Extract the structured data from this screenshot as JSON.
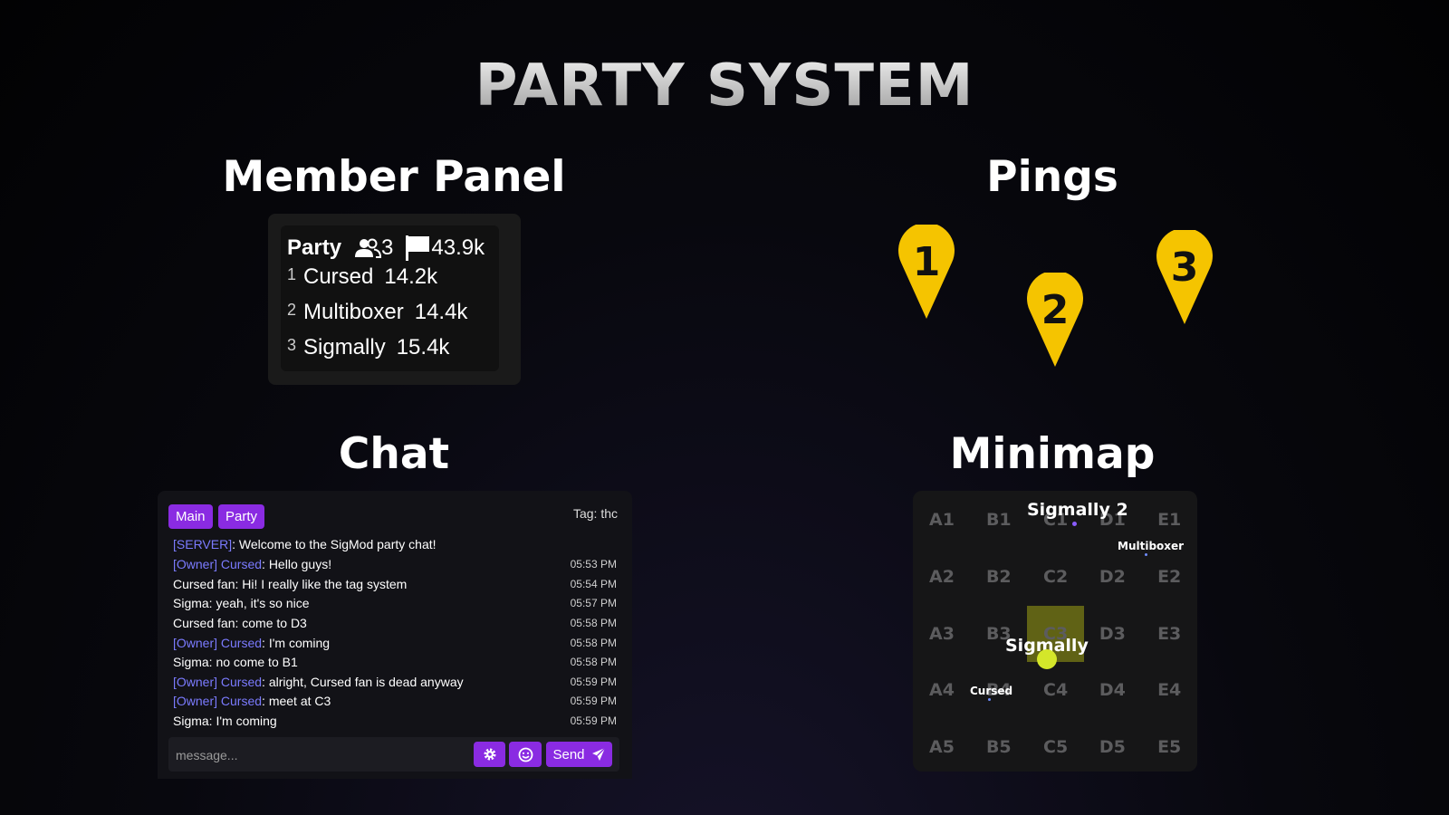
{
  "title": "PARTY SYSTEM",
  "sections": {
    "member_panel": "Member Panel",
    "pings": "Pings",
    "chat": "Chat",
    "minimap": "Minimap"
  },
  "member_panel": {
    "party_label": "Party",
    "member_count": "3",
    "total_score": "43.9k",
    "icons": [
      "users-icon",
      "flag-icon"
    ],
    "members": [
      {
        "rank": "1",
        "name": "Cursed",
        "score": "14.2k"
      },
      {
        "rank": "2",
        "name": "Multiboxer",
        "score": "14.4k"
      },
      {
        "rank": "3",
        "name": "Sigmally",
        "score": "15.4k"
      }
    ]
  },
  "pings": [
    {
      "label": "1",
      "color": "#f5c400"
    },
    {
      "label": "2",
      "color": "#f5c400"
    },
    {
      "label": "3",
      "color": "#f5c400"
    }
  ],
  "chat": {
    "tabs": [
      "Main",
      "Party"
    ],
    "tag_label": "Tag: thc",
    "messages": [
      {
        "prefix": "[SERVER]",
        "text": ": Welcome to the SigMod party chat!",
        "time": ""
      },
      {
        "prefix": "[Owner] Cursed",
        "text": ": Hello guys!",
        "time": "05:53 PM"
      },
      {
        "prefix": "",
        "text": "Cursed fan: Hi! I really like the tag system",
        "time": "05:54 PM"
      },
      {
        "prefix": "",
        "text": "Sigma: yeah, it's so nice",
        "time": "05:57 PM"
      },
      {
        "prefix": "",
        "text": "Cursed fan: come to D3",
        "time": "05:58 PM"
      },
      {
        "prefix": "[Owner] Cursed",
        "text": ": I'm coming",
        "time": "05:58 PM"
      },
      {
        "prefix": "",
        "text": "Sigma: no come to B1",
        "time": "05:58 PM"
      },
      {
        "prefix": "[Owner] Cursed",
        "text": ": alright, Cursed fan is dead anyway",
        "time": "05:59 PM"
      },
      {
        "prefix": "[Owner] Cursed",
        "text": ": meet at C3",
        "time": "05:59 PM"
      },
      {
        "prefix": "",
        "text": "Sigma: I'm coming",
        "time": "05:59 PM"
      }
    ],
    "input_placeholder": "message...",
    "send_label": "Send",
    "accent_color": "#8a2be2",
    "prefix_color": "#7b7bff"
  },
  "minimap": {
    "columns": [
      "A",
      "B",
      "C",
      "D",
      "E"
    ],
    "rows": [
      "1",
      "2",
      "3",
      "4",
      "5"
    ],
    "cells": [
      "A1",
      "B1",
      "C1",
      "D1",
      "E1",
      "A2",
      "B2",
      "C2",
      "D2",
      "E2",
      "A3",
      "B3",
      "C3",
      "D3",
      "E3",
      "A4",
      "B4",
      "C4",
      "D4",
      "E4",
      "A5",
      "B5",
      "C5",
      "D5",
      "E5"
    ],
    "highlighted_cell": "C3",
    "players": [
      "Sigmally 2",
      "Multiboxer",
      "Sigmally",
      "Cursed"
    ],
    "highlight_color": "#babe14",
    "player_dot_color": "#d4e62a"
  }
}
